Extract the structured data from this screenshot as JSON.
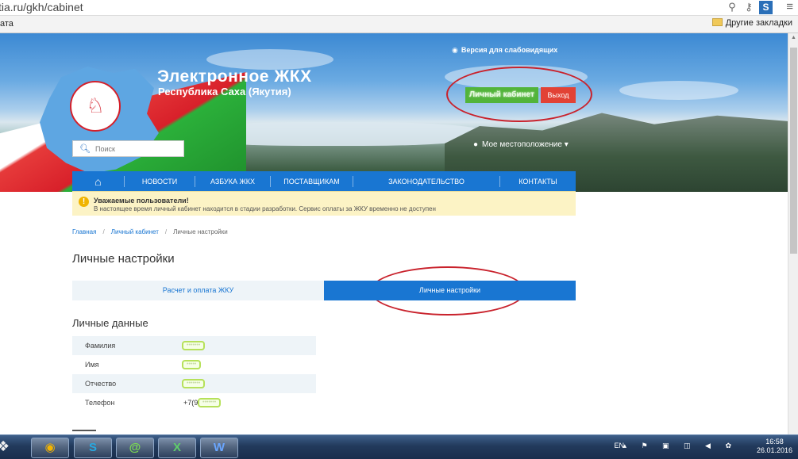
{
  "browser": {
    "url": "tia.ru/gkh/cabinet",
    "bookmarks_left": "ата",
    "bookmarks_right": "Другие закладки"
  },
  "header": {
    "title": "Электронное ЖКХ",
    "subtitle": "Республика Саха (Якутия)",
    "vision_link": "Версия для слабовидящих",
    "login_button": "Личный кабинет",
    "logout_button": "Выход",
    "location": "Мое местоположение",
    "search_placeholder": "Поиск"
  },
  "nav": {
    "items": [
      "НОВОСТИ",
      "АЗБУКА ЖКХ",
      "ПОСТАВЩИКАМ",
      "ЗАКОНОДАТЕЛЬСТВО",
      "КОНТАКТЫ"
    ]
  },
  "notice": {
    "heading": "Уважаемые пользователи!",
    "text": "В настоящее время личный кабинет находится в стадии разработки. Сервис оплаты за ЖКУ временно не доступен"
  },
  "breadcrumb": {
    "home": "Главная",
    "cabinet": "Личный кабинет",
    "current": "Личные настройки"
  },
  "page": {
    "title": "Личные настройки",
    "tabs": [
      "Расчет и оплата ЖКУ",
      "Личные настройки"
    ],
    "section": "Личные данные"
  },
  "personal": {
    "surname_label": "Фамилия",
    "surname_value": "•••••••",
    "name_label": "Имя",
    "name_value": "•••••",
    "patronymic_label": "Отчество",
    "patronymic_value": "•••••••",
    "phone_label": "Телефон",
    "phone_prefix": "+7(9",
    "phone_value": "•••••••"
  },
  "taskbar": {
    "lang": "EN",
    "time": "16:58",
    "date": "26.01.2016"
  }
}
